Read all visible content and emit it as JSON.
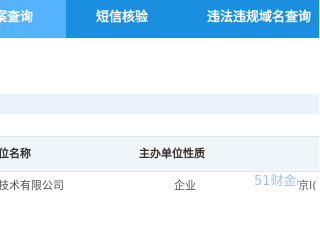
{
  "nav": {
    "tabs": [
      {
        "label": "案查询",
        "active": true
      },
      {
        "label": "短信核验",
        "active": false
      },
      {
        "label": "违法违规域名查询",
        "active": false
      }
    ]
  },
  "table": {
    "headers": [
      "位名称",
      "主办单位性质"
    ],
    "rows": [
      {
        "name": "技术有限公司",
        "nature": "企业",
        "extra": "京I("
      }
    ]
  },
  "watermark": "51财金ₕ",
  "colors": {
    "nav_bg": "#1a8fe0",
    "nav_active": "#54b2ff",
    "separator": "#eaf3fb",
    "header_bg": "#f0f5fa"
  }
}
